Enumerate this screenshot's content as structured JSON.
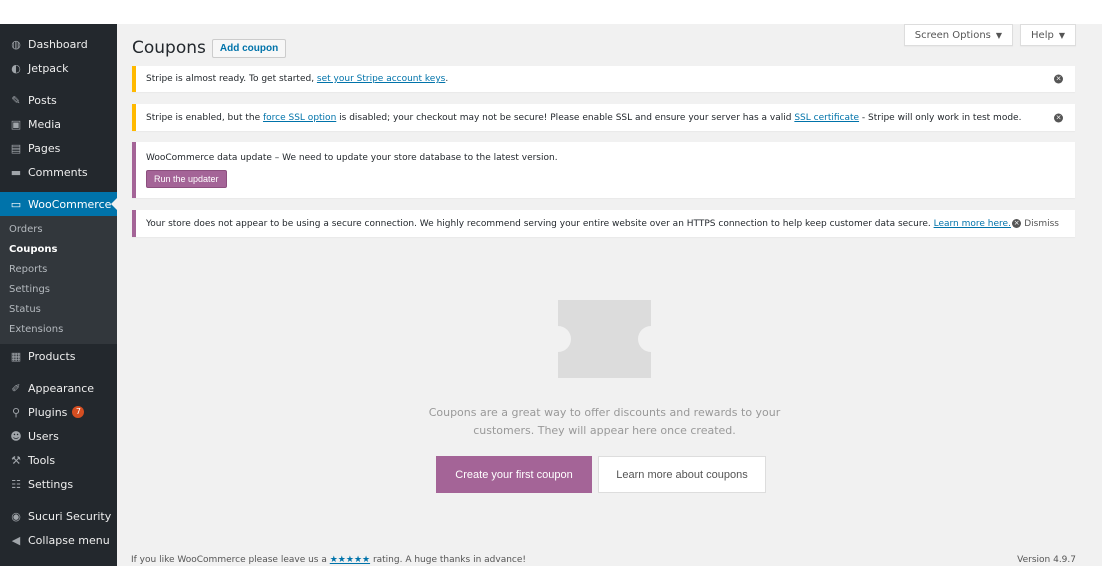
{
  "sidebar": {
    "top_items": [
      {
        "icon": "dashboard-icon",
        "glyph": "◍",
        "label": "Dashboard"
      },
      {
        "icon": "jetpack-icon",
        "glyph": "◐",
        "label": "Jetpack"
      }
    ],
    "content_items": [
      {
        "icon": "posts-icon",
        "glyph": "✎",
        "label": "Posts"
      },
      {
        "icon": "media-icon",
        "glyph": "▣",
        "label": "Media"
      },
      {
        "icon": "pages-icon",
        "glyph": "▤",
        "label": "Pages"
      },
      {
        "icon": "comments-icon",
        "glyph": "▬",
        "label": "Comments"
      }
    ],
    "woocommerce": {
      "icon": "woocommerce-icon",
      "glyph": "▭",
      "label": "WooCommerce"
    },
    "woo_submenu": [
      "Orders",
      "Coupons",
      "Reports",
      "Settings",
      "Status",
      "Extensions"
    ],
    "products": {
      "icon": "products-icon",
      "glyph": "▦",
      "label": "Products"
    },
    "admin_items": [
      {
        "icon": "appearance-icon",
        "glyph": "✐",
        "label": "Appearance"
      },
      {
        "icon": "plugins-icon",
        "glyph": "⚲",
        "label": "Plugins",
        "badge": "7"
      },
      {
        "icon": "users-icon",
        "glyph": "☻",
        "label": "Users"
      },
      {
        "icon": "tools-icon",
        "glyph": "⚒",
        "label": "Tools"
      },
      {
        "icon": "settings-icon",
        "glyph": "☷",
        "label": "Settings"
      }
    ],
    "sucuri": {
      "icon": "sucuri-icon",
      "glyph": "◉",
      "label": "Sucuri Security"
    },
    "collapse": {
      "icon": "collapse-icon",
      "glyph": "◀",
      "label": "Collapse menu"
    }
  },
  "header": {
    "screen_options": "Screen Options",
    "help": "Help",
    "title": "Coupons",
    "add_coupon": "Add coupon"
  },
  "notices": {
    "stripe_keys_text": "Stripe is almost ready. To get started, ",
    "stripe_keys_link": "set your Stripe account keys",
    "stripe_keys_end": ".",
    "ssl_text_1": "Stripe is enabled, but the ",
    "ssl_link_1": "force SSL option",
    "ssl_text_2": " is disabled; your checkout may not be secure! Please enable SSL and ensure your server has a valid ",
    "ssl_link_2": "SSL certificate",
    "ssl_text_3": " - Stripe will only work in test mode.",
    "update_text": "WooCommerce data update – We need to update your store database to the latest version.",
    "update_button": "Run the updater",
    "https_text": "Your store does not appear to be using a secure connection. We highly recommend serving your entire website over an HTTPS connection to help keep customer data secure. ",
    "https_link": "Learn more here.",
    "dismiss": "Dismiss"
  },
  "empty_state": {
    "message": "Coupons are a great way to offer discounts and rewards to your customers. They will appear here once created.",
    "primary_button": "Create your first coupon",
    "secondary_button": "Learn more about coupons"
  },
  "footer": {
    "text_before": "If you like WooCommerce please leave us a ",
    "stars": "★★★★★",
    "text_after": " rating. A huge thanks in advance!",
    "version": "Version 4.9.7"
  },
  "colors": {
    "sidebar_bg": "#23282d",
    "active_menu": "#0073aa",
    "woo_purple": "#a46497",
    "warning_yellow": "#ffb900",
    "plugin_badge": "#d54e21"
  }
}
